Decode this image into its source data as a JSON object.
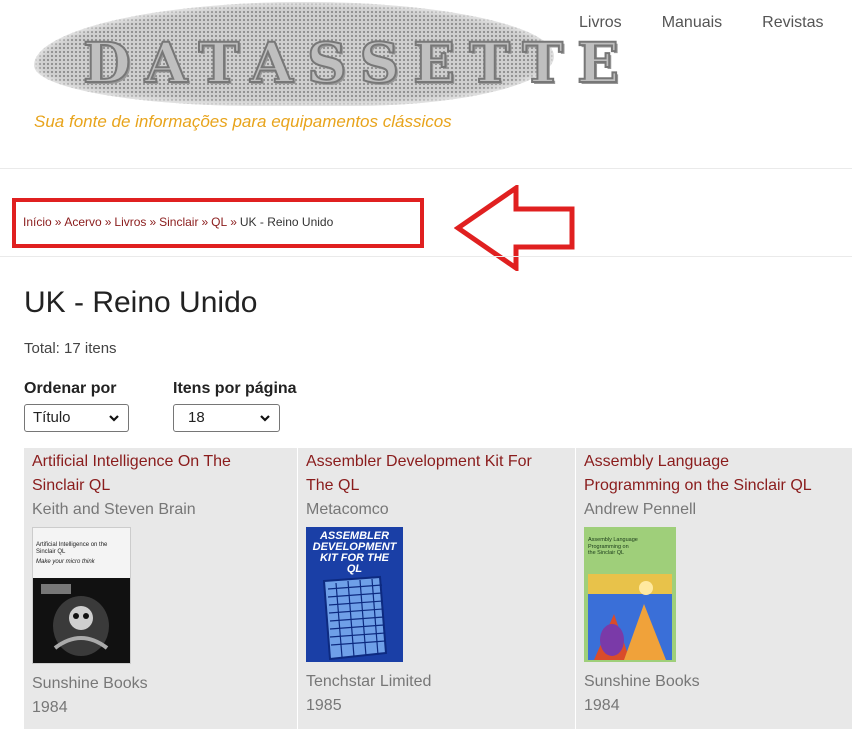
{
  "site": {
    "logo_text": "DATASSETTE",
    "tagline": "Sua fonte de informações para equipamentos clássicos"
  },
  "nav": [
    "Livros",
    "Manuais",
    "Revistas"
  ],
  "breadcrumb": {
    "items": [
      "Início",
      "Acervo",
      "Livros",
      "Sinclair",
      "QL"
    ],
    "separator": "»",
    "current": "UK - Reino Unido"
  },
  "page": {
    "title": "UK - Reino Unido",
    "total": "Total: 17 itens"
  },
  "controls": {
    "sort_label": "Ordenar por",
    "sort_value": "Título",
    "perpage_label": "Itens por página",
    "perpage_value": "18"
  },
  "items": [
    {
      "title_1": "Artificial Intelligence On The",
      "title_2": "Sinclair QL",
      "author": "Keith and Steven Brain",
      "publisher": "Sunshine Books",
      "year": "1984",
      "cover_text": [
        "Artificial Intelligence on the",
        "Sinclair QL",
        "Make your micro think"
      ]
    },
    {
      "title_1": "Assembler Development Kit For",
      "title_2": "The QL",
      "author": "Metacomco",
      "publisher": "Tenchstar Limited",
      "year": "1985",
      "cover_text": [
        "ASSEMBLER",
        "DEVELOPMENT",
        "KIT FOR THE",
        "QL"
      ]
    },
    {
      "title_1": "Assembly Language",
      "title_2": "Programming on the Sinclair QL",
      "author": "Andrew Pennell",
      "publisher": "Sunshine Books",
      "year": "1984",
      "cover_text": [
        "Assembly Language",
        "Programming on",
        "the Sinclair QL"
      ]
    }
  ],
  "colors": {
    "link": "#8a1c1c",
    "tagline": "#e8a41c",
    "highlight_box": "#e02020",
    "grid_bg": "#e8e8e8"
  }
}
